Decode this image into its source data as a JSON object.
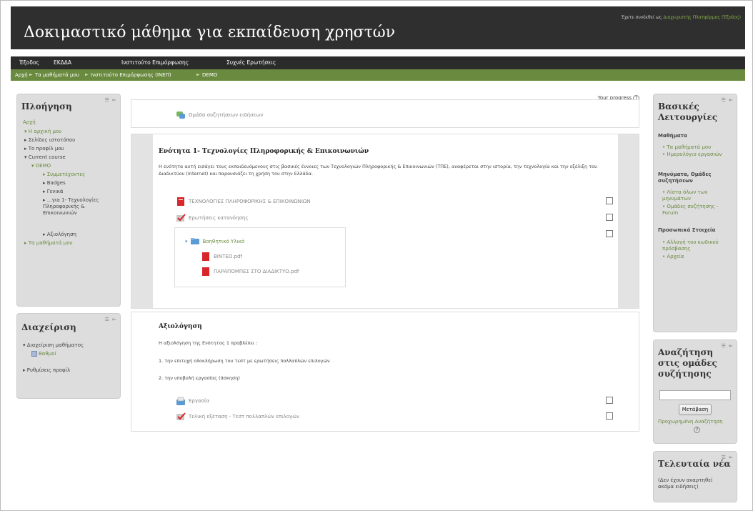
{
  "header": {
    "title": "Δοκιμαστικό μάθημα για εκπαίδευση χρηστών",
    "login_text": "Έχετε συνδεθεί ως",
    "login_user": "Διαχειριστής Πλατφόρμας (Έξοδος)"
  },
  "menu": [
    "Έξοδος",
    "ΕΚΔΔΑ",
    "Ινστιτούτο Επιμόρφωσης",
    "Συχνές Ερωτήσεις"
  ],
  "breadcrumb": [
    "Αρχή",
    "Τα μαθήματά μου",
    "Ινστιτούτο Επιμόρφωσης (ΙΝΕΠ)",
    "DEMO"
  ],
  "navigation": {
    "title": "Πλοήγηση",
    "items": [
      "Αρχή",
      "Η αρχική μου",
      "Σελίδες ιστοτόπου",
      "Το προφίλ μου",
      "Current course",
      "DEMO",
      "Συμμετέχοντες",
      "Badges",
      "Γενικά",
      "…για 1- Τεχνολογίες Πληροφορικής & Επικοινωνιών",
      "Αξιολόγηση",
      "Τα μαθήματά μου"
    ]
  },
  "administration": {
    "title": "Διαχείριση",
    "items": [
      "Διαχείριση μαθήματος",
      "Βαθμοί",
      "Ρυθμίσεις προφίλ"
    ]
  },
  "basic_functions": {
    "title": "Βασικές Λειτουργίες",
    "sections": [
      {
        "heading": "Μαθήματα",
        "items": [
          "Τα μαθήματά μου",
          "Ημερολόγιο εργασιών"
        ]
      },
      {
        "heading": "Μηνύματα, Ομάδες συζητήσεων",
        "items": [
          "Λίστα όλων των μηνυμάτων",
          "Ομάδες συζήτησης - Forum"
        ]
      },
      {
        "heading": "Προσωπικά Στοιχεία",
        "items": [
          "Αλλαγή του κωδικού πρόσβασης",
          "Αρχεία"
        ]
      }
    ]
  },
  "forum_search": {
    "title": "Αναζήτηση στις ομάδες συζήτησης",
    "button": "Μετάβαση",
    "advanced": "Προχωρημένη Αναζήτηση"
  },
  "latest_news": {
    "title": "Τελευταία νέα",
    "text": "(Δεν έχουν αναρτηθεί ακόμα ειδήσεις)"
  },
  "course": {
    "progress_label": "Your progress",
    "general_forum": "Ομάδα συζητήσεων ειδήσεων",
    "section1": {
      "title": "Ενότητα 1- Τεχνολογίες Πληροφορικής & Επικοινωνιών",
      "summary": "Η ενότητα αυτή εισάγει τους εκπαιδευόμενους στις βασικές έννοιες των Τεχνολογιών Πληροφορικής & Επικοινωνιών (ΤΠΕ), αναφέρεται στην ιστορία, την τεχνολογία και την εξέλιξη του Διαδικτύου (Internet) και παρουσιάζει τη χρήση του στην Ελλάδα.",
      "activities": [
        "ΤΕΧΝΟΛΟΓΙΕΣ ΠΛΗΡΟΦΟΡΙΚΗΣ & ΕΠΙΚΟΙΝΩΝΙΩΝ",
        "Ερωτήσεις κατανόησης"
      ],
      "folder": "Βοηθητικό Υλικό",
      "files": [
        "ΒΙΝΤΕΟ.pdf",
        "ΠΑΡΑΠΟΜΠΕΣ ΣΤΟ ΔΙΑΔΙΚΤΥΟ.pdf"
      ]
    },
    "section2": {
      "title": "Αξιολόγηση",
      "intro": "Η αξιολόγηση της Ενότητας 1 προβλέπει :",
      "point1": "1. την επιτυχή ολοκλήρωση του τεστ με ερωτήσεις πολλαπλών επιλογών",
      "point2": "2. την υποβολή εργασίας (άσκηση)",
      "activities": [
        "Εργασία",
        "Τελική εξέταση - Τεστ πολλαπλών επιλογών"
      ]
    }
  },
  "colors": {
    "header_bg": "#2f2f2f",
    "breadcrumb_bg": "#6a8a3f",
    "link_green": "#6a8a3f",
    "block_bg": "#dddddd"
  }
}
